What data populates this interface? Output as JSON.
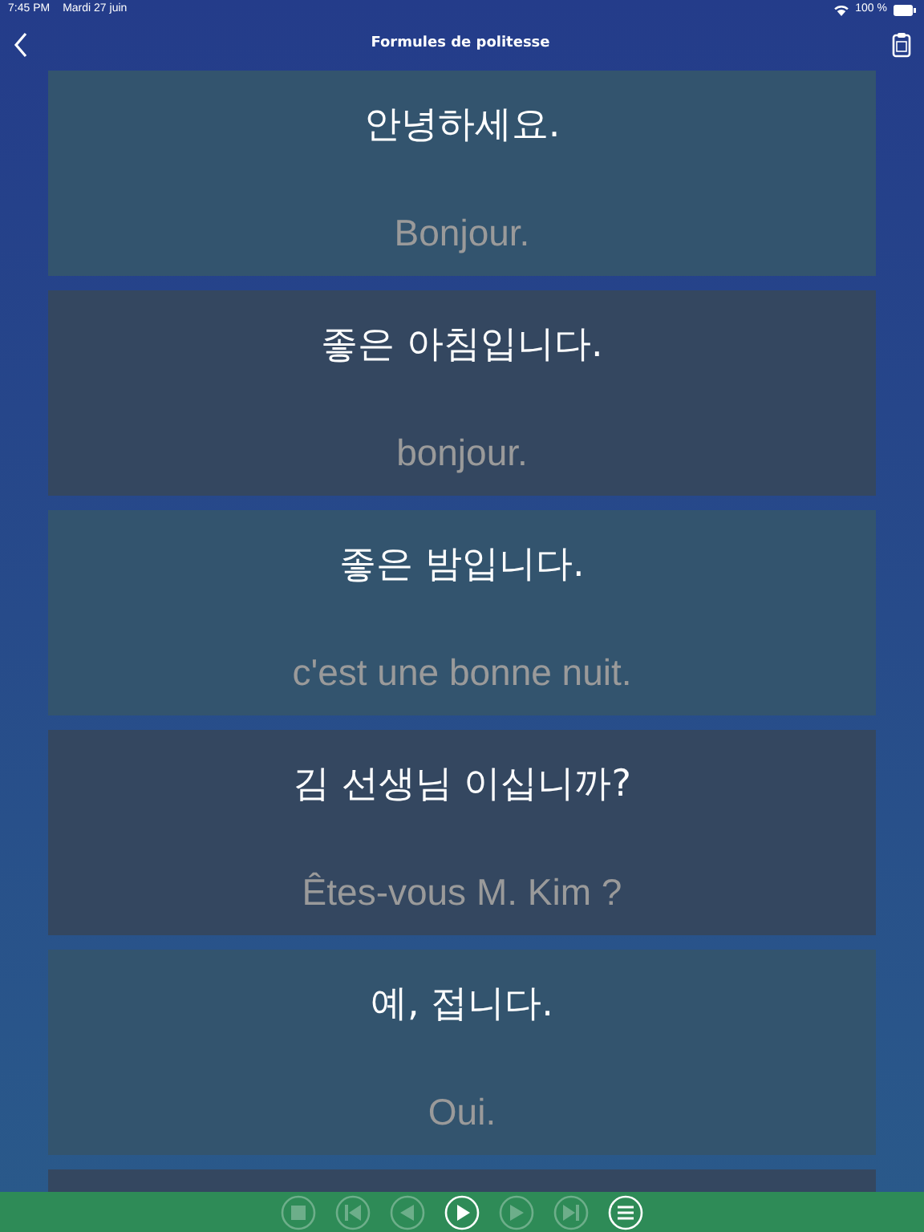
{
  "status_bar": {
    "time": "7:45 PM",
    "date": "Mardi 27 juin",
    "battery": "100 %"
  },
  "nav": {
    "title": "Formules de politesse"
  },
  "phrases": [
    {
      "korean": "안녕하세요.",
      "french": "Bonjour."
    },
    {
      "korean": "좋은 아침입니다.",
      "french": "bonjour."
    },
    {
      "korean": "좋은 밤입니다.",
      "french": "c'est une bonne nuit."
    },
    {
      "korean": "김 선생님 이십니까?",
      "french": "Êtes-vous M. Kim ?"
    },
    {
      "korean": "예, 접니다.",
      "french": "Oui."
    }
  ],
  "player": [
    {
      "kind": "stop",
      "disabled": true
    },
    {
      "kind": "first",
      "disabled": true
    },
    {
      "kind": "prev",
      "disabled": true
    },
    {
      "kind": "play",
      "disabled": false
    },
    {
      "kind": "next",
      "disabled": true
    },
    {
      "kind": "last",
      "disabled": true
    },
    {
      "kind": "menu",
      "disabled": false
    }
  ]
}
